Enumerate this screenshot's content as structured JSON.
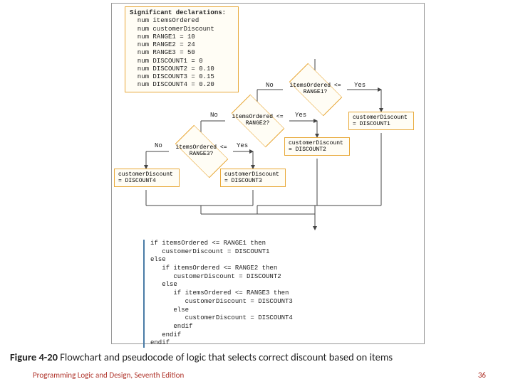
{
  "declarations": {
    "title": "Significant declarations:",
    "lines": [
      "num itemsOrdered",
      "num customerDiscount",
      "num RANGE1 = 10",
      "num RANGE2 = 24",
      "num RANGE3 = 50",
      "num DISCOUNT1 = 0",
      "num DISCOUNT2 = 0.10",
      "num DISCOUNT3 = 0.15",
      "num DISCOUNT4 = 0.20"
    ]
  },
  "diamonds": {
    "d1": "itemsOrdered <= RANGE1?",
    "d2": "itemsOrdered <= RANGE2?",
    "d3": "itemsOrdered <= RANGE3?"
  },
  "rects": {
    "r1": "customerDiscount = DISCOUNT1",
    "r2": "customerDiscount = DISCOUNT2",
    "r3": "customerDiscount = DISCOUNT3",
    "r4": "customerDiscount = DISCOUNT4"
  },
  "labels": {
    "no": "No",
    "yes": "Yes"
  },
  "pseudocode": "if itemsOrdered <= RANGE1 then\n   customerDiscount = DISCOUNT1\nelse\n   if itemsOrdered <= RANGE2 then\n      customerDiscount = DISCOUNT2\n   else\n      if itemsOrdered <= RANGE3 then\n         customerDiscount = DISCOUNT3\n      else\n         customerDiscount = DISCOUNT4\n      endif\n   endif\nendif",
  "caption": {
    "label": "Figure 4-20",
    "text": " Flowchart and pseudocode of logic that selects correct discount based on items"
  },
  "footer": {
    "book": "Programming Logic and Design, Seventh Edition",
    "page": "36"
  }
}
